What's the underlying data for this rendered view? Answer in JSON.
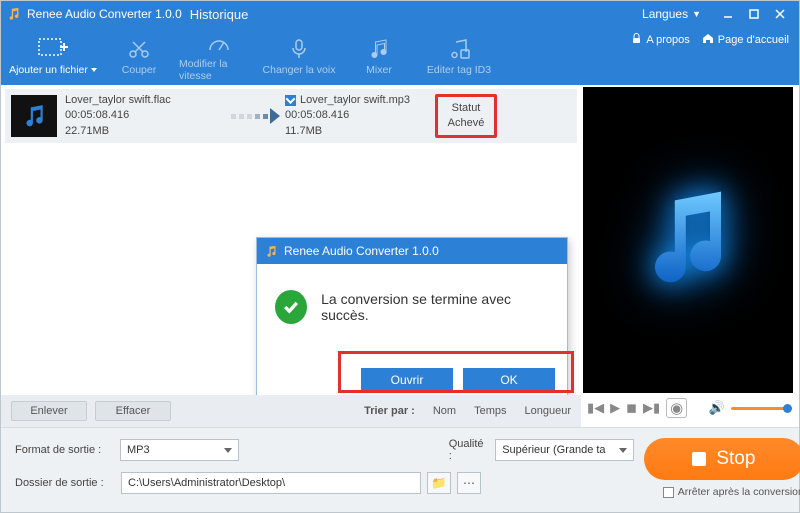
{
  "titlebar": {
    "title": "Renee Audio Converter 1.0.0",
    "page": "Historique",
    "lang": "Langues"
  },
  "toolbar": {
    "add": "Ajouter un fichier",
    "cut": "Couper",
    "speed": "Modifier la vitesse",
    "voice": "Changer la voix",
    "mix": "Mixer",
    "id3": "Editer tag ID3",
    "about": "A propos",
    "home": "Page d'accueil"
  },
  "row": {
    "in": {
      "name": "Lover_taylor swift.flac",
      "dur": "00:05:08.416",
      "size": "22.71MB"
    },
    "out": {
      "name": "Lover_taylor swift.mp3",
      "dur": "00:05:08.416",
      "size": "11.7MB"
    },
    "status_lbl": "Statut",
    "status_val": "Achevé"
  },
  "listbtm": {
    "remove": "Enlever",
    "clear": "Effacer",
    "sortby": "Trier par :",
    "name": "Nom",
    "time": "Temps",
    "length": "Longueur"
  },
  "bottom": {
    "format_lbl": "Format de sortie :",
    "format_val": "MP3",
    "quality_lbl": "Qualité :",
    "quality_val": "Supérieur (Grande ta",
    "folder_lbl": "Dossier de sortie :",
    "folder_val": "C:\\Users\\Administrator\\Desktop\\",
    "stop": "Stop",
    "stop_after": "Arrêter après la conversion"
  },
  "dialog": {
    "title": "Renee Audio Converter 1.0.0",
    "msg": "La conversion se termine avec succès.",
    "open": "Ouvrir",
    "ok": "OK"
  }
}
